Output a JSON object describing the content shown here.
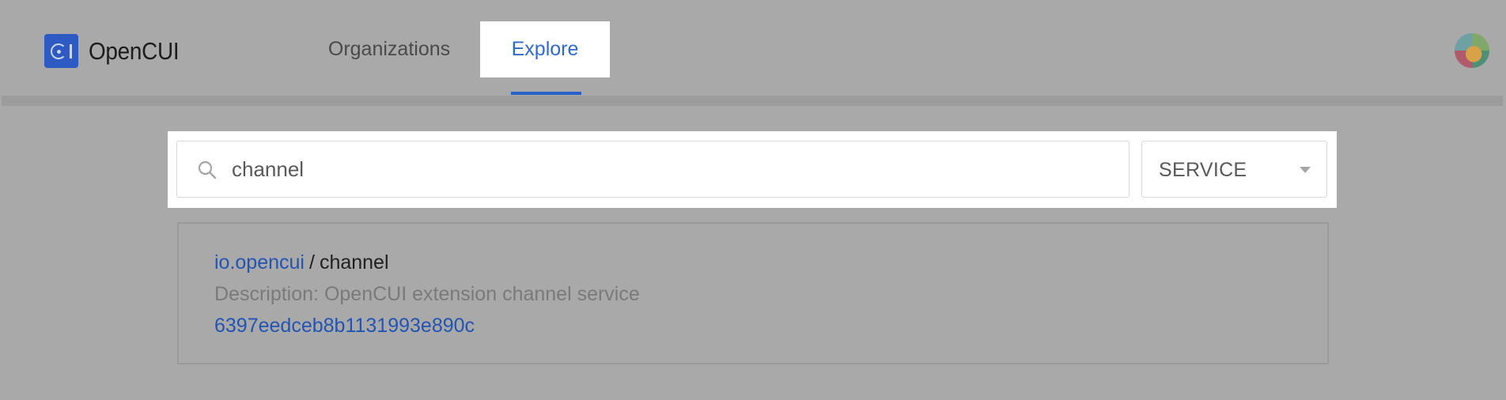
{
  "app": {
    "name": "OpenCUI"
  },
  "nav": {
    "tabs": [
      {
        "label": "Organizations",
        "active": false
      },
      {
        "label": "Explore",
        "active": true
      }
    ]
  },
  "search": {
    "value": "channel",
    "type_selected": "SERVICE"
  },
  "results": [
    {
      "org": "io.opencui",
      "separator": "/",
      "name": "channel",
      "description": "Description: OpenCUI extension channel service",
      "id": "6397eedceb8b1131993e890c"
    }
  ],
  "colors": {
    "brand": "#2d5ac3",
    "link": "#2354b2",
    "active_tab_text": "#2e6ad6",
    "overlay_bg": "#a9a9a9"
  },
  "icons": {
    "search": "search-icon",
    "dropdown": "chevron-down-icon",
    "logo": "opencui-logo-icon"
  }
}
